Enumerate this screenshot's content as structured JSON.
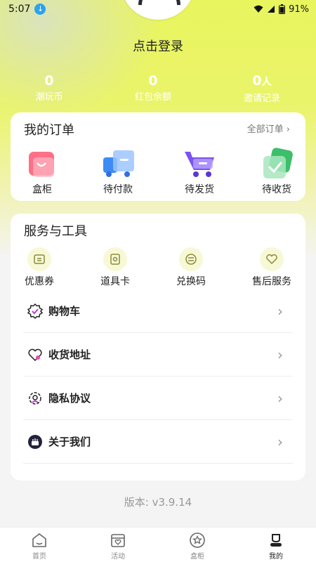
{
  "status_bar": {
    "time": "5:07",
    "battery": "91%"
  },
  "profile": {
    "login_label": "点击登录"
  },
  "stats": [
    {
      "value": "0",
      "unit": "",
      "label": "潮玩币"
    },
    {
      "value": "0",
      "unit": "",
      "label": "红包余额"
    },
    {
      "value": "0",
      "unit": "人",
      "label": "邀请记录"
    }
  ],
  "orders": {
    "title": "我的订单",
    "all_label": "全部订单",
    "items": [
      {
        "label": "盒柜",
        "icon": "shopping-bag-icon"
      },
      {
        "label": "待付款",
        "icon": "delivery-truck-icon"
      },
      {
        "label": "待发货",
        "icon": "shopping-cart-icon"
      },
      {
        "label": "待收货",
        "icon": "checkmark-card-icon"
      }
    ]
  },
  "services": {
    "title": "服务与工具",
    "tools": [
      {
        "label": "优惠券",
        "icon": "coupon-icon"
      },
      {
        "label": "道具卡",
        "icon": "prop-card-icon"
      },
      {
        "label": "兑换码",
        "icon": "exchange-code-icon"
      },
      {
        "label": "售后服务",
        "icon": "after-sales-heart-icon"
      }
    ],
    "rows": [
      {
        "label": "购物车",
        "icon": "cart-badge-icon"
      },
      {
        "label": "收货地址",
        "icon": "heart-location-icon"
      },
      {
        "label": "隐私协议",
        "icon": "privacy-gear-icon"
      },
      {
        "label": "关于我们",
        "icon": "about-cake-icon"
      }
    ]
  },
  "version": "版本: v3.9.14",
  "tabbar": {
    "active": "我的",
    "items": [
      {
        "label": "首页",
        "icon": "home-icon"
      },
      {
        "label": "活动",
        "icon": "activity-box-icon"
      },
      {
        "label": "盒柜",
        "icon": "star-circle-icon"
      },
      {
        "label": "我的",
        "icon": "profile-icon"
      }
    ]
  },
  "colors": {
    "accent": "#e9f55e",
    "bag": "#ff6f86",
    "truck": "#3d8bf5",
    "cart": "#7b52f3",
    "check": "#3dbf6a"
  }
}
